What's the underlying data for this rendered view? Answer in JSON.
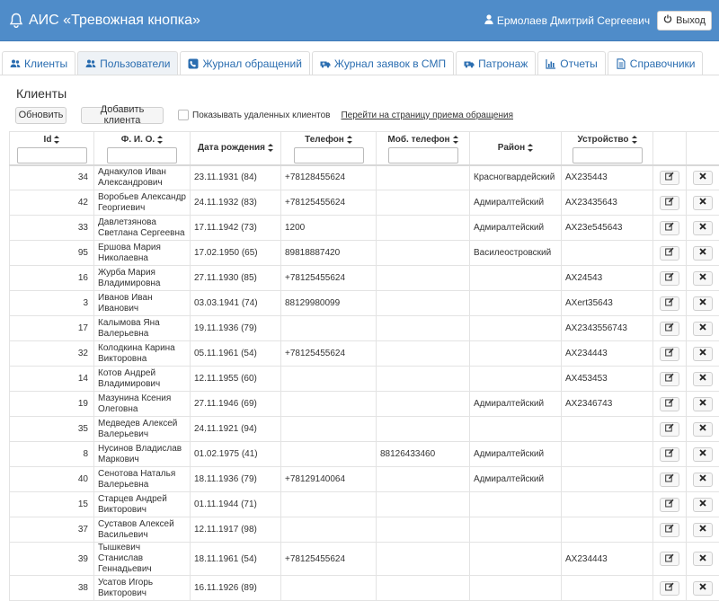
{
  "app": {
    "title": "АИС «Тревожная кнопка»",
    "user_name": "Ермолаев Дмитрий Сергеевич",
    "logout_label": "Выход",
    "bell_icon": "bell-icon",
    "user_icon": "user-icon",
    "power_icon": "power-icon"
  },
  "tabs": [
    {
      "label": "Клиенты",
      "icon": "users-icon"
    },
    {
      "label": "Пользователи",
      "icon": "users-icon"
    },
    {
      "label": "Журнал обращений",
      "icon": "phone-icon"
    },
    {
      "label": "Журнал заявок в СМП",
      "icon": "ambulance-icon"
    },
    {
      "label": "Патронаж",
      "icon": "ambulance-icon"
    },
    {
      "label": "Отчеты",
      "icon": "chart-icon"
    },
    {
      "label": "Справочники",
      "icon": "book-icon"
    }
  ],
  "page": {
    "title": "Клиенты",
    "refresh_label": "Обновить",
    "add_label": "Добавить клиента",
    "show_deleted_label": "Показывать удаленных клиентов",
    "goto_link_label": "Перейти на страницу приема обращения"
  },
  "table": {
    "headers": {
      "id": "Id",
      "name": "Ф. И. О.",
      "birth": "Дата рождения",
      "phone": "Телефон",
      "mobile": "Моб. телефон",
      "district": "Район",
      "device": "Устройство"
    },
    "rows": [
      {
        "id": "34",
        "name": "Аднакулов Иван Александрович",
        "birth": "23.11.1931 (84)",
        "phone": "+78128455624",
        "mobile": "",
        "district": "Красногвардейский",
        "device": "AX235443"
      },
      {
        "id": "42",
        "name": "Воробьев Александр Георгиевич",
        "birth": "24.11.1932 (83)",
        "phone": "+78125455624",
        "mobile": "",
        "district": "Адмиралтейский",
        "device": "AX23435643"
      },
      {
        "id": "33",
        "name": "Давлетзянова Светлана Сергеевна",
        "birth": "17.11.1942 (73)",
        "phone": "1200",
        "mobile": "",
        "district": "Адмиралтейский",
        "device": "AX23e545643"
      },
      {
        "id": "95",
        "name": "Ершова Мария Николаевна",
        "birth": "17.02.1950 (65)",
        "phone": "89818887420",
        "mobile": "",
        "district": "Василеостровский",
        "device": ""
      },
      {
        "id": "16",
        "name": "Журба Мария Владимировна",
        "birth": "27.11.1930 (85)",
        "phone": "+78125455624",
        "mobile": "",
        "district": "",
        "device": "AX24543"
      },
      {
        "id": "3",
        "name": "Иванов Иван Иванович",
        "birth": "03.03.1941 (74)",
        "phone": "88129980099",
        "mobile": "",
        "district": "",
        "device": "AXert35643"
      },
      {
        "id": "17",
        "name": "Калымова Яна Валерьевна",
        "birth": "19.11.1936 (79)",
        "phone": "",
        "mobile": "",
        "district": "",
        "device": "AX2343556743"
      },
      {
        "id": "32",
        "name": "Колодкина Карина Викторовна",
        "birth": "05.11.1961 (54)",
        "phone": "+78125455624",
        "mobile": "",
        "district": "",
        "device": "AX234443"
      },
      {
        "id": "14",
        "name": "Котов Андрей Владимирович",
        "birth": "12.11.1955 (60)",
        "phone": "",
        "mobile": "",
        "district": "",
        "device": "AX453453"
      },
      {
        "id": "19",
        "name": "Мазунина Ксения Олеговна",
        "birth": "27.11.1946 (69)",
        "phone": "",
        "mobile": "",
        "district": "Адмиралтейский",
        "device": "AX2346743"
      },
      {
        "id": "35",
        "name": "Медведев Алексей Валерьевич",
        "birth": "24.11.1921 (94)",
        "phone": "",
        "mobile": "",
        "district": "",
        "device": ""
      },
      {
        "id": "8",
        "name": "Нусинов Владислав Маркович",
        "birth": "01.02.1975 (41)",
        "phone": "",
        "mobile": "88126433460",
        "district": "Адмиралтейский",
        "device": ""
      },
      {
        "id": "40",
        "name": "Сенотова Наталья Валерьевна",
        "birth": "18.11.1936 (79)",
        "phone": "+78129140064",
        "mobile": "",
        "district": "Адмиралтейский",
        "device": ""
      },
      {
        "id": "15",
        "name": "Старцев Андрей Викторович",
        "birth": "01.11.1944 (71)",
        "phone": "",
        "mobile": "",
        "district": "",
        "device": ""
      },
      {
        "id": "37",
        "name": "Суставов Алексей Васильевич",
        "birth": "12.11.1917 (98)",
        "phone": "",
        "mobile": "",
        "district": "",
        "device": ""
      },
      {
        "id": "39",
        "name": "Тышкевич Станислав Геннадьевич",
        "birth": "18.11.1961 (54)",
        "phone": "+78125455624",
        "mobile": "",
        "district": "",
        "device": "AX234443"
      },
      {
        "id": "38",
        "name": "Усатов Игорь Викторович",
        "birth": "16.11.1926 (89)",
        "phone": "",
        "mobile": "",
        "district": "",
        "device": ""
      }
    ],
    "edit_icon": "edit-icon",
    "delete_icon": "delete-icon"
  },
  "colors": {
    "header_bg": "#4f8cc9",
    "link": "#2a6db0"
  }
}
